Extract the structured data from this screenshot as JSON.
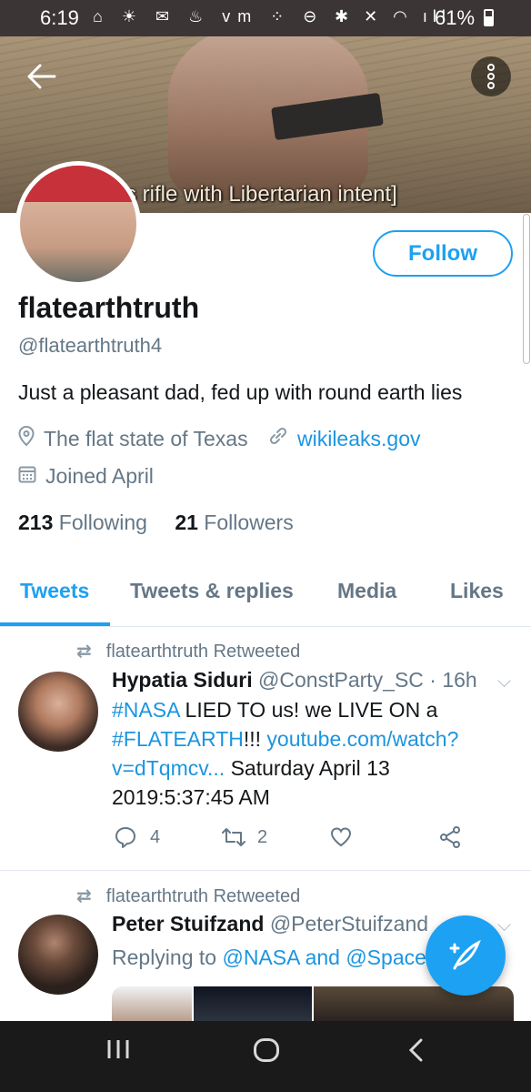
{
  "status_bar": {
    "time": "6:19",
    "left_icons": "⌂ ☀ ✉ ♨ vm ⁘ ⊖",
    "right_icons": "✱ ✕ ◠ ıll",
    "battery": "61%"
  },
  "banner": {
    "caption": "s rifle with Libertarian intent]"
  },
  "header": {
    "back_icon": "arrow-left",
    "menu_icon": "more-vertical"
  },
  "profile": {
    "display_name": "flatearthtruth",
    "handle": "@flatearthtruth4",
    "bio": "Just a pleasant dad, fed up with round earth lies",
    "location": "The flat state of Texas",
    "website": "wikileaks.gov",
    "joined": "Joined April",
    "following_count": "213",
    "following_label": "Following",
    "followers_count": "21",
    "followers_label": "Followers",
    "follow_button": "Follow"
  },
  "tabs": [
    {
      "label": "Tweets",
      "active": true
    },
    {
      "label": "Tweets & replies",
      "active": false
    },
    {
      "label": "Media",
      "active": false
    },
    {
      "label": "Likes",
      "active": false
    }
  ],
  "tweets": [
    {
      "retweet_label": "flatearthtruth Retweeted",
      "name": "Hypatia Siduri",
      "handle": "@ConstParty_SC",
      "time": "· 16h",
      "line1_tag": "#NASA",
      "line1_rest": " LIED TO us! we LIVE ON a",
      "line2_tag": "#FLATEARTH",
      "line2_rest": "!!! ",
      "line2_link": "youtube.com/watch?",
      "line3_link": "v=dTqmcv...",
      "line3_rest": " Saturday April 13",
      "line4": "2019:5:37:45 AM",
      "reply_count": "4",
      "retweet_count": "2"
    },
    {
      "retweet_label": "flatearthtruth Retweeted",
      "name": "Peter Stuifzand",
      "handle": "@PeterStuifzand",
      "replying_prefix": "Replying to",
      "replying_to": "@NASA and @Space"
    }
  ],
  "colors": {
    "accent": "#1da1f2",
    "secondary_text": "#657786"
  }
}
